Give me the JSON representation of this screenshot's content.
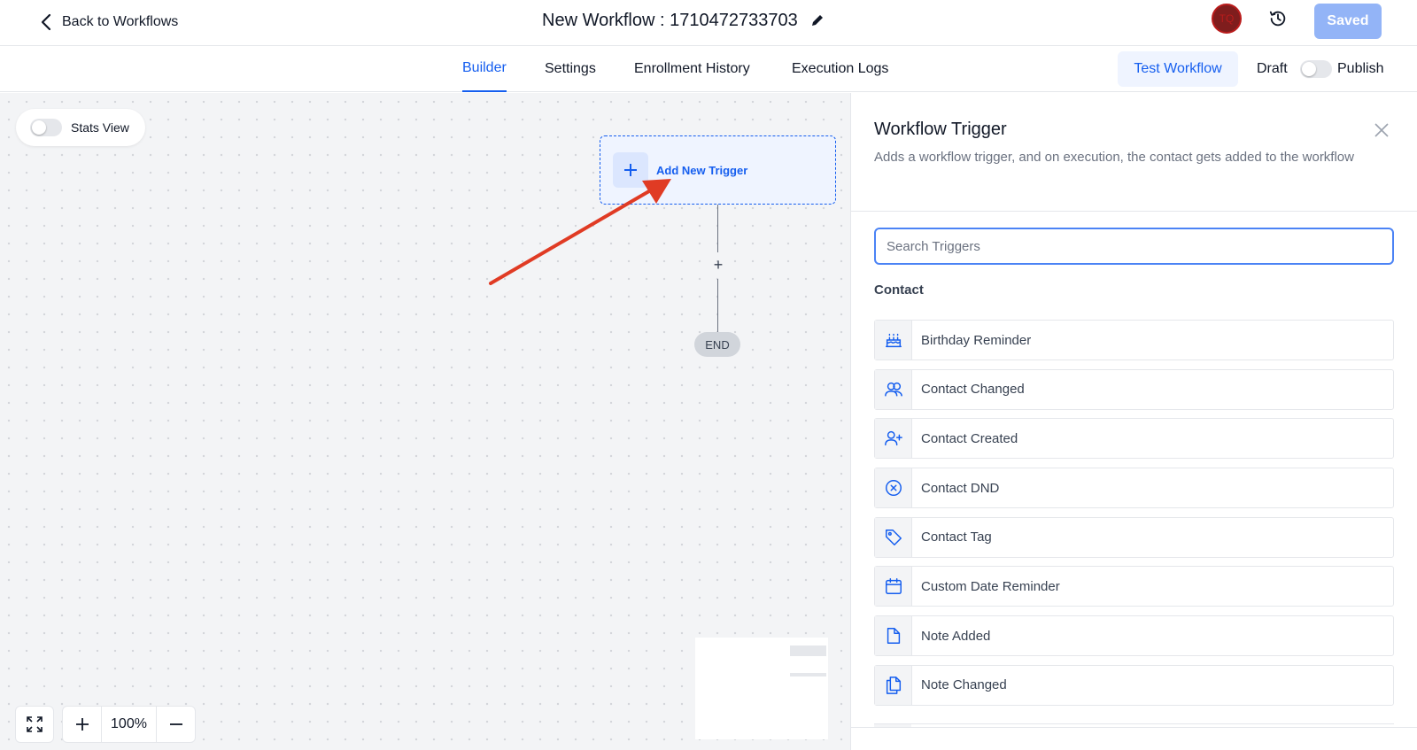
{
  "header": {
    "back_label": "Back to Workflows",
    "workflow_title": "New Workflow : 1710472733703",
    "avatar_initials": "TQ",
    "saved_label": "Saved"
  },
  "tabs": [
    {
      "label": "Builder",
      "active": true
    },
    {
      "label": "Settings",
      "active": false
    },
    {
      "label": "Enrollment History",
      "active": false
    },
    {
      "label": "Execution Logs",
      "active": false
    }
  ],
  "actions": {
    "test_label": "Test Workflow",
    "draft_label": "Draft",
    "publish_label": "Publish",
    "published": false
  },
  "canvas": {
    "stats_label": "Stats View",
    "stats_enabled": false,
    "trigger_node_label": "Add New Trigger",
    "end_label": "END",
    "zoom_level": "100%"
  },
  "panel": {
    "title": "Workflow Trigger",
    "description": "Adds a workflow trigger, and on execution, the contact gets added to the workflow",
    "search_placeholder": "Search Triggers",
    "section_label": "Contact",
    "triggers": [
      {
        "label": "Birthday Reminder",
        "icon": "cake-icon"
      },
      {
        "label": "Contact Changed",
        "icon": "users-icon"
      },
      {
        "label": "Contact Created",
        "icon": "user-plus-icon"
      },
      {
        "label": "Contact DND",
        "icon": "x-circle-icon"
      },
      {
        "label": "Contact Tag",
        "icon": "tag-icon"
      },
      {
        "label": "Custom Date Reminder",
        "icon": "calendar-icon"
      },
      {
        "label": "Note Added",
        "icon": "file-icon"
      },
      {
        "label": "Note Changed",
        "icon": "files-icon"
      }
    ]
  },
  "colors": {
    "accent": "#155eef",
    "annotation_arrow": "#e03b24"
  }
}
